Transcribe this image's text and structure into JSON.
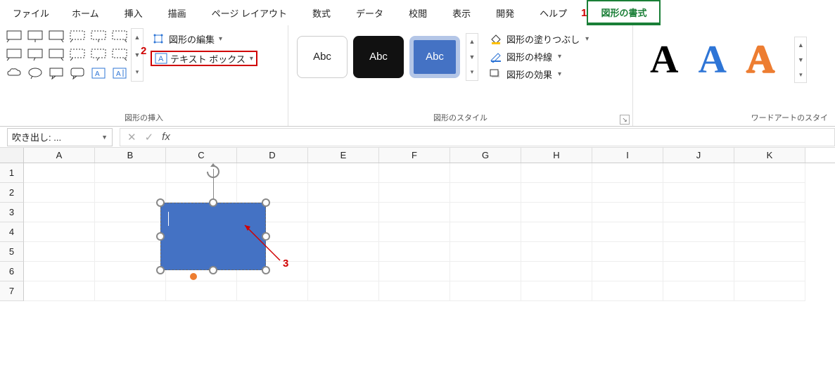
{
  "menu": {
    "file": "ファイル",
    "home": "ホーム",
    "insert": "挿入",
    "draw": "描画",
    "pagelayout": "ページ レイアウト",
    "formulas": "数式",
    "data": "データ",
    "review": "校閲",
    "view": "表示",
    "developer": "開発",
    "help": "ヘルプ",
    "shapeformat": "図形の書式"
  },
  "annotations": {
    "a1": "1",
    "a2": "2",
    "a3": "3"
  },
  "ribbon": {
    "insert_shapes": {
      "label": "図形の挿入",
      "edit_shape": "図形の編集",
      "text_box": "テキスト ボックス"
    },
    "shape_styles": {
      "label": "図形のスタイル",
      "sample": "Abc",
      "fill": "図形の塗りつぶし",
      "outline": "図形の枠線",
      "effects": "図形の効果"
    },
    "wordart": {
      "label": "ワードアートのスタイ",
      "char": "A"
    }
  },
  "namebox": {
    "value": "吹き出し: ..."
  },
  "formula": {
    "value": ""
  },
  "columns": [
    "A",
    "B",
    "C",
    "D",
    "E",
    "F",
    "G",
    "H",
    "I",
    "J",
    "K"
  ],
  "rows": [
    "1",
    "2",
    "3",
    "4",
    "5",
    "6",
    "7"
  ]
}
